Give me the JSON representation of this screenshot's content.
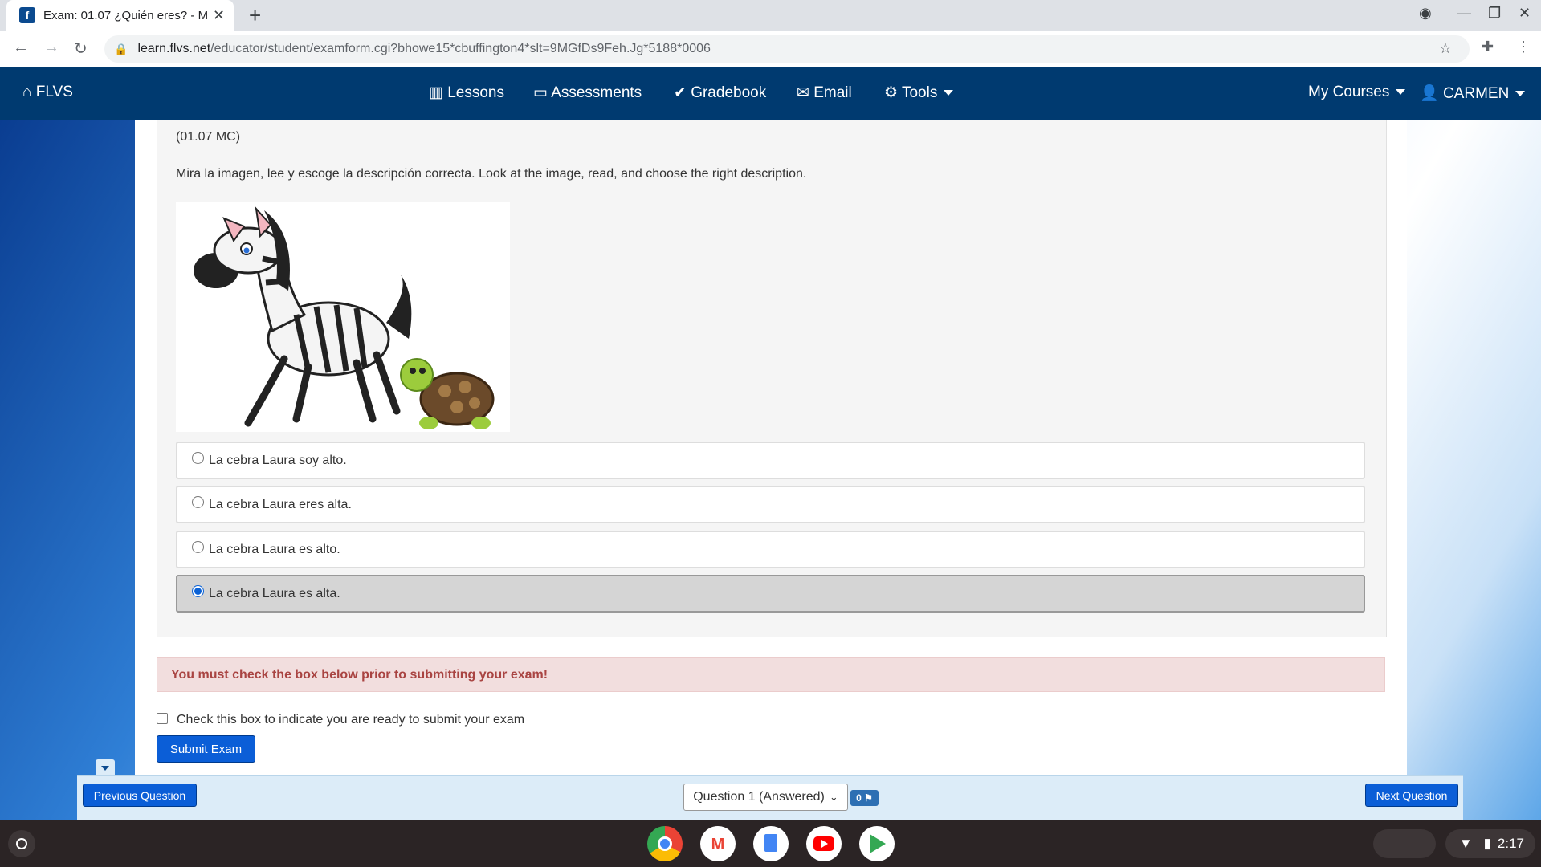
{
  "browser": {
    "tab_title": "Exam: 01.07 ¿Quién eres? - M/J",
    "url_host": "learn.flvs.net",
    "url_path": "/educator/student/examform.cgi?bhowe15*cbuffington4*slt=9MGfDs9Feh.Jg*5188*0006"
  },
  "nav": {
    "home": "FLVS",
    "lessons": "Lessons",
    "assessments": "Assessments",
    "gradebook": "Gradebook",
    "email": "Email",
    "tools": "Tools",
    "my_courses": "My Courses",
    "user": "CARMEN"
  },
  "question": {
    "number": "(01.07 MC)",
    "prompt": "Mira la imagen, lee y escoge la descripción correcta. Look at the image, read, and choose the right description.",
    "options": [
      {
        "label": "La cebra Laura soy alto.",
        "selected": false
      },
      {
        "label": "La cebra Laura eres alta.",
        "selected": false
      },
      {
        "label": "La cebra Laura es alto.",
        "selected": false
      },
      {
        "label": "La cebra Laura es alta.",
        "selected": true
      }
    ]
  },
  "alert": "You must check the box below prior to submitting your exam!",
  "ready_checkbox_label": "Check this box to indicate you are ready to submit your exam",
  "submit_label": "Submit Exam",
  "footer": {
    "prev": "Previous Question",
    "next": "Next Question",
    "question_select": "Question 1 (Answered)",
    "flag_count": "0"
  },
  "taskbar": {
    "time": "2:17"
  },
  "colors": {
    "nav_bg": "#003a70",
    "button": "#0b5ed7",
    "alert_text": "#a94442"
  }
}
